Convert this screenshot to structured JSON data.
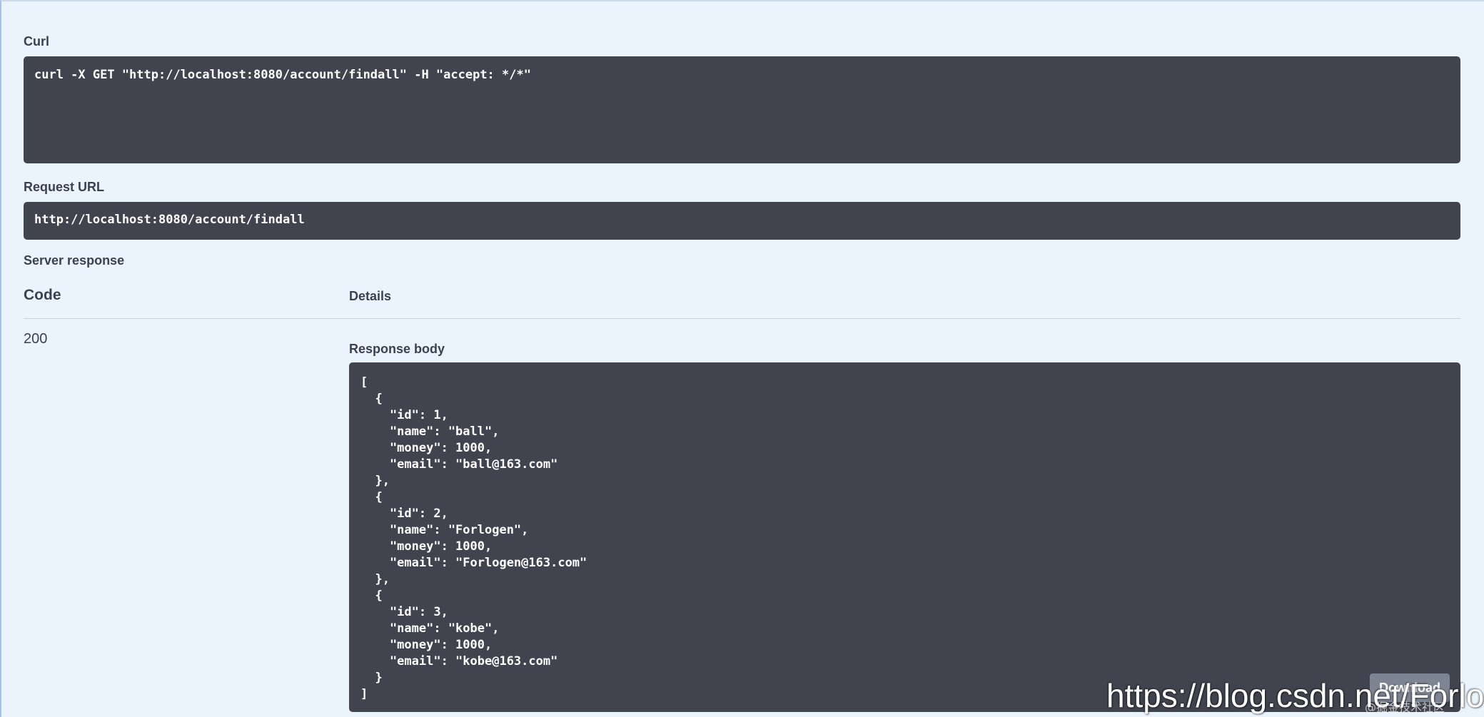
{
  "curl": {
    "label": "Curl",
    "command": "curl -X GET \"http://localhost:8080/account/findall\" -H \"accept: */*\""
  },
  "request_url": {
    "label": "Request URL",
    "value": "http://localhost:8080/account/findall"
  },
  "server_response": {
    "label": "Server response",
    "columns": {
      "code": "Code",
      "details": "Details"
    },
    "status_code": "200",
    "response_body_label": "Response body",
    "body_lines": [
      "[",
      "  {",
      "    \"id\": 1,",
      "    \"name\": \"ball\",",
      "    \"money\": 1000,",
      "    \"email\": \"ball@163.com\"",
      "  },",
      "  {",
      "    \"id\": 2,",
      "    \"name\": \"Forlogen\",",
      "    \"money\": 1000,",
      "    \"email\": \"Forlogen@163.com\"",
      "  },",
      "  {",
      "    \"id\": 3,",
      "    \"name\": \"kobe\",",
      "    \"money\": 1000,",
      "    \"email\": \"kobe@163.com\"",
      "  }",
      "]"
    ],
    "download_label": "Download"
  },
  "watermark": {
    "text": "https://blog.csdn.net/Forloger",
    "sub": "@掘金技术社区"
  },
  "colors": {
    "background": "#ebf3fd",
    "code_block": "#41444e",
    "text": "#3b4151",
    "download_button": "#7d8492"
  }
}
